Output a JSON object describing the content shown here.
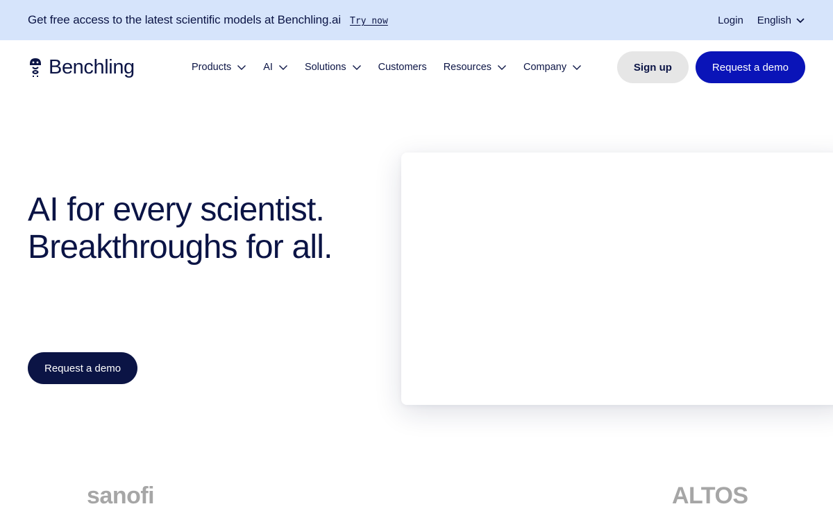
{
  "announcement": {
    "text": "Get free access to the latest scientific models at Benchling.ai",
    "link": "Try now",
    "login": "Login",
    "language": "English"
  },
  "nav": {
    "logo_text": "Benchling",
    "items": [
      {
        "label": "Products",
        "has_dropdown": true
      },
      {
        "label": "AI",
        "has_dropdown": true
      },
      {
        "label": "Solutions",
        "has_dropdown": true
      },
      {
        "label": "Customers",
        "has_dropdown": false
      },
      {
        "label": "Resources",
        "has_dropdown": true
      },
      {
        "label": "Company",
        "has_dropdown": true
      }
    ],
    "signup": "Sign up",
    "demo": "Request a demo"
  },
  "hero": {
    "title_line1": "AI for every scientist.",
    "title_line2": "Breakthroughs for all.",
    "cta": "Request a demo"
  },
  "customers": [
    "sanofi",
    "ALTOS"
  ],
  "colors": {
    "announcement_bg": "#d6e4fb",
    "primary_navy": "#0b1445",
    "primary_blue": "#0a14b8",
    "secondary_bg": "#e6e6e6"
  }
}
